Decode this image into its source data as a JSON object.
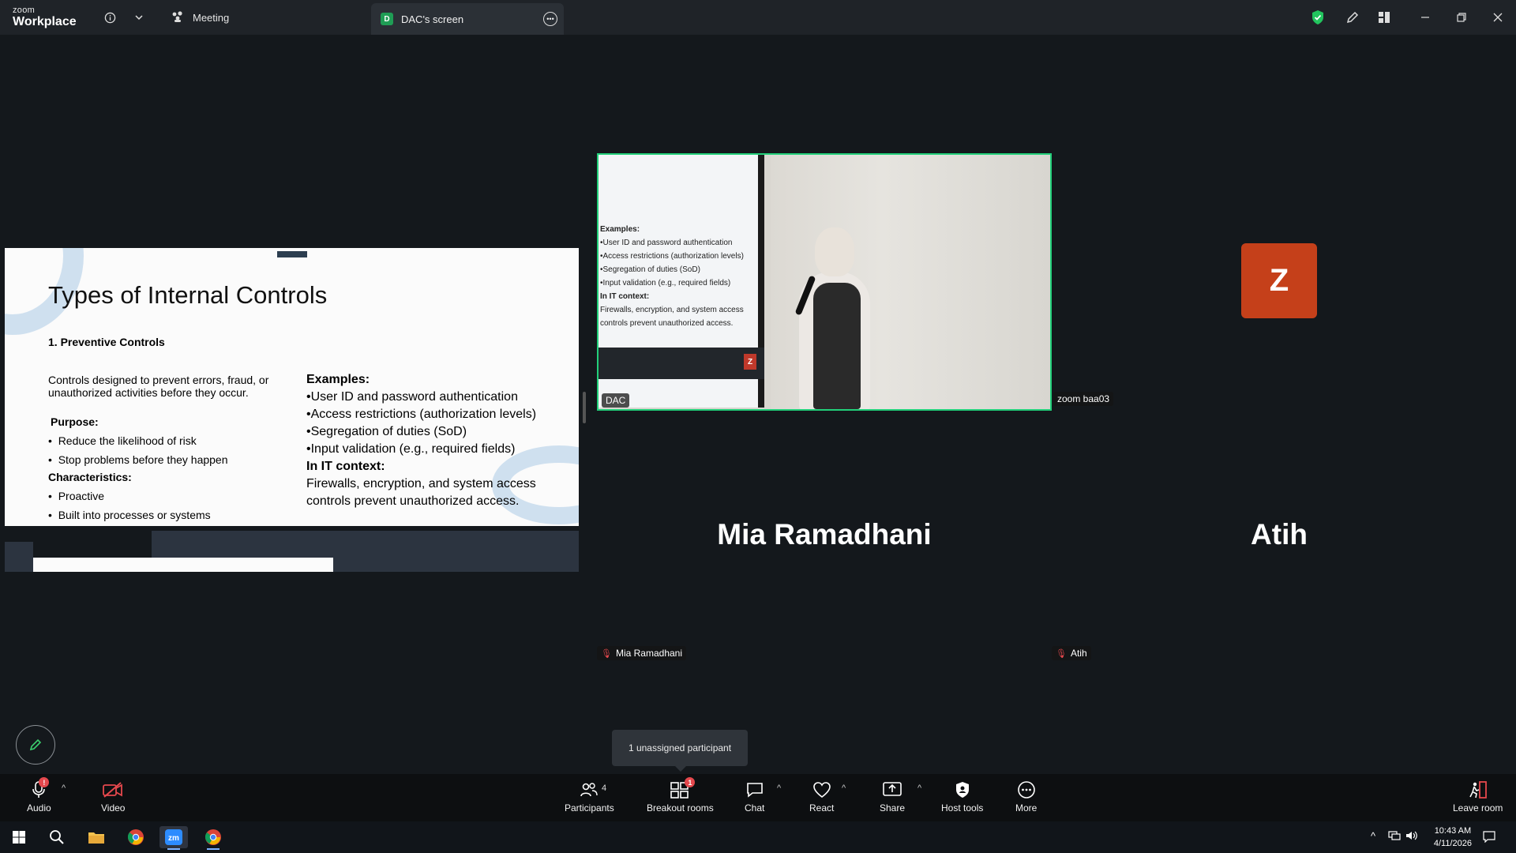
{
  "titlebar": {
    "brand_small": "zoom",
    "brand_big": "Workplace",
    "meeting_tab": "Meeting",
    "screen_tab_initial": "D",
    "screen_tab": "DAC's screen"
  },
  "slide": {
    "title": "Types of Internal Controls",
    "subheading": "1.   Preventive Controls",
    "description": "Controls designed to prevent errors, fraud, or unauthorized activities before they occur.",
    "purpose_label": "Purpose:",
    "purpose_items": [
      "Reduce the likelihood of risk",
      "Stop problems before they happen"
    ],
    "characteristics_label": "Characteristics:",
    "characteristics_items": [
      "Proactive",
      "Built into processes or systems"
    ],
    "examples_label": "Examples:",
    "examples_items": [
      "•User ID and password authentication",
      "•Access restrictions (authorization levels)",
      "•Segregation of duties (SoD)",
      "•Input validation (e.g., required fields)"
    ],
    "it_label": "In IT context:",
    "it_text": "Firewalls, encryption, and system access controls prevent unauthorized access."
  },
  "video_tile": {
    "screen_text": [
      "Examples:",
      "•User ID and password authentication",
      "•Access restrictions (authorization levels)",
      "•Segregation of duties (SoD)",
      "•Input validation (e.g., required fields)",
      "In IT context:",
      "Firewalls, encryption, and system access",
      "controls prevent unauthorized access."
    ],
    "screen_z": "Z",
    "label": "DAC",
    "neighbor_label": "zoom baa03"
  },
  "participants": {
    "avatar_letter": "Z",
    "mia_big_name": "Mia Ramadhani",
    "mia_tag": "Mia Ramadhani",
    "atih_big_name": "Atih",
    "atih_tag": "Atih"
  },
  "tooltip": "1 unassigned participant",
  "toolbar": {
    "audio": "Audio",
    "video": "Video",
    "participants": "Participants",
    "participants_count": "4",
    "breakout": "Breakout rooms",
    "breakout_badge": "1",
    "chat": "Chat",
    "react": "React",
    "share": "Share",
    "host_tools": "Host tools",
    "more": "More",
    "leave": "Leave room"
  },
  "taskbar": {
    "time": "10:43 AM",
    "date": "4/11/2026"
  },
  "colors": {
    "accent_green": "#22d07a",
    "avatar_orange": "#c5401a",
    "alert_red": "#e5484d"
  },
  "icons": [
    "info-icon",
    "chevron-down-icon",
    "meeting-icon",
    "more-icon",
    "shield-icon",
    "pencil-icon",
    "layout-icon",
    "minimize-icon",
    "restore-icon",
    "close-icon",
    "microphone-icon",
    "video-icon",
    "participants-icon",
    "breakout-icon",
    "chat-icon",
    "react-icon",
    "share-icon",
    "host-tools-icon",
    "more-icon",
    "leave-icon",
    "windows-start-icon",
    "search-icon",
    "folder-icon",
    "chrome-icon",
    "zoom-app-icon"
  ]
}
